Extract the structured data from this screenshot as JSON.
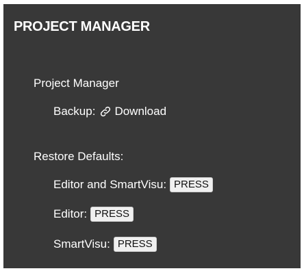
{
  "header": {
    "title": "PROJECT MANAGER"
  },
  "project_manager": {
    "heading": "Project Manager",
    "backup_label": "Backup:",
    "download_label": "Download",
    "download_icon": "link-icon"
  },
  "restore": {
    "heading": "Restore Defaults:",
    "items": [
      {
        "label": "Editor and SmartVisu:",
        "button": "PRESS"
      },
      {
        "label": "Editor:",
        "button": "PRESS"
      },
      {
        "label": "SmartVisu:",
        "button": "PRESS"
      }
    ]
  },
  "colors": {
    "panel_background": "#383838",
    "text": "#ffffff",
    "button_background": "#f0f0f0"
  }
}
